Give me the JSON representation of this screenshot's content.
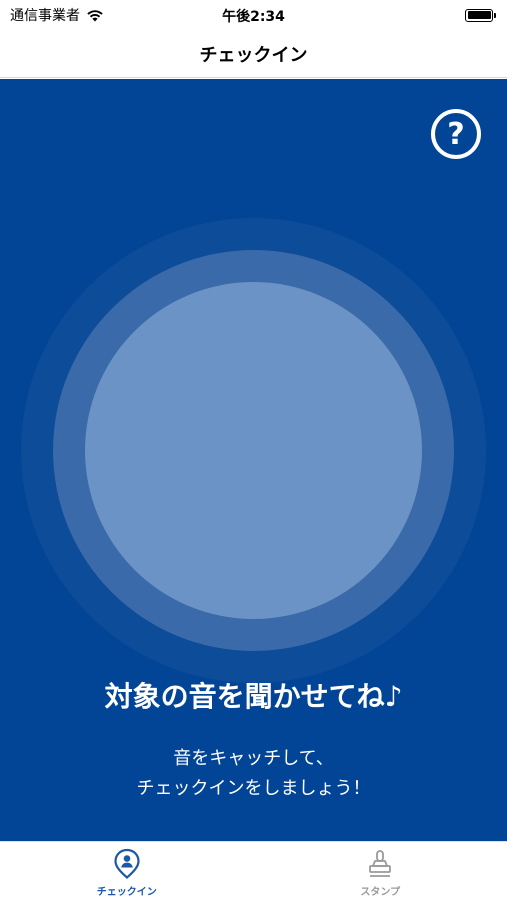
{
  "status_bar": {
    "carrier": "通信事業者",
    "time": "午後2:34",
    "wifi_icon": "wifi-icon",
    "battery_icon": "battery-icon"
  },
  "nav": {
    "title": "チェックイン"
  },
  "main": {
    "background_color": "#024597",
    "help_icon": "question-circle-icon",
    "help_label": "?",
    "headline": "対象の音を聞かせてね♪",
    "subtext_line1": "音をキャッチして、",
    "subtext_line2": "チェックインをしましょう！"
  },
  "tab_bar": {
    "tabs": [
      {
        "label": "チェックイン",
        "icon": "location-pin-person-icon",
        "active": true,
        "color": "#1b58a8"
      },
      {
        "label": "スタンプ",
        "icon": "stamp-icon",
        "active": false,
        "color": "#9a9a9a"
      }
    ]
  }
}
